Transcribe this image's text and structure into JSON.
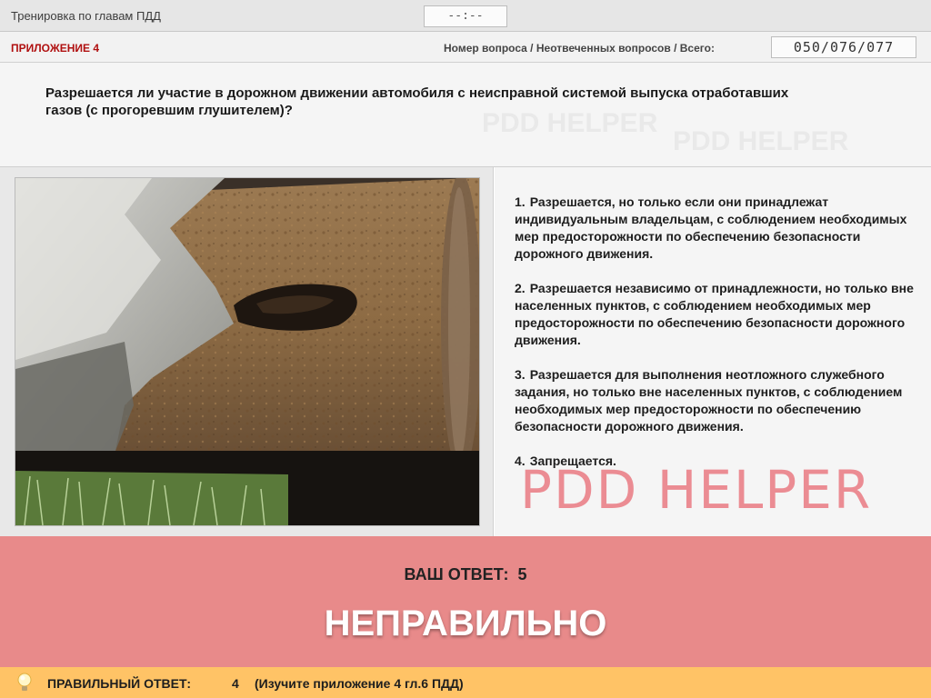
{
  "topbar": {
    "title": "Тренировка по главам ПДД",
    "timer": "--:--"
  },
  "infobar": {
    "appendix": "ПРИЛОЖЕНИЕ 4",
    "question_label": "Номер вопроса / Неотвеченных вопросов / Всего:",
    "counter": "050/076/077"
  },
  "question": {
    "text": "Разрешается ли участие в дорожном движении автомобиля с неисправной системой выпуска отработавших газов (с прогоревшим глушителем)?"
  },
  "answers": [
    {
      "num": "1.",
      "text": "Разрешается, но только если они принадлежат индивидуальным владельцам, с соблюдением необходимых мер предосторожности по обеспечению безопасности дорожного движения."
    },
    {
      "num": "2.",
      "text": "Разрешается независимо от принадлежности, но только вне населенных пунктов, с соблюдением необходимых мер предосторожности по обеспечению безопасности дорожного движения."
    },
    {
      "num": "3.",
      "text": "Разрешается для выполнения неотложного служебного задания, но только вне населенных пунктов, с соблюдением необходимых мер предосторожности по обеспечению безопасности дорожного движения."
    },
    {
      "num": "4.",
      "text": "Запрещается."
    }
  ],
  "watermark": "PDD HELPER",
  "result": {
    "your_answer_label": "ВАШ ОТВЕТ:",
    "your_answer_value": "5",
    "verdict": "НЕПРАВИЛЬНО"
  },
  "footer": {
    "icon": "lightbulb-icon",
    "correct_label": "ПРАВИЛЬНЫЙ ОТВЕТ:",
    "correct_value": "4",
    "hint": "(Изучите приложение 4 гл.6 ПДД)"
  },
  "colors": {
    "result_bg": "#e88a8a",
    "footer_bg": "#ffc366",
    "appendix_text": "#b01010",
    "watermark": "#e8646e"
  }
}
